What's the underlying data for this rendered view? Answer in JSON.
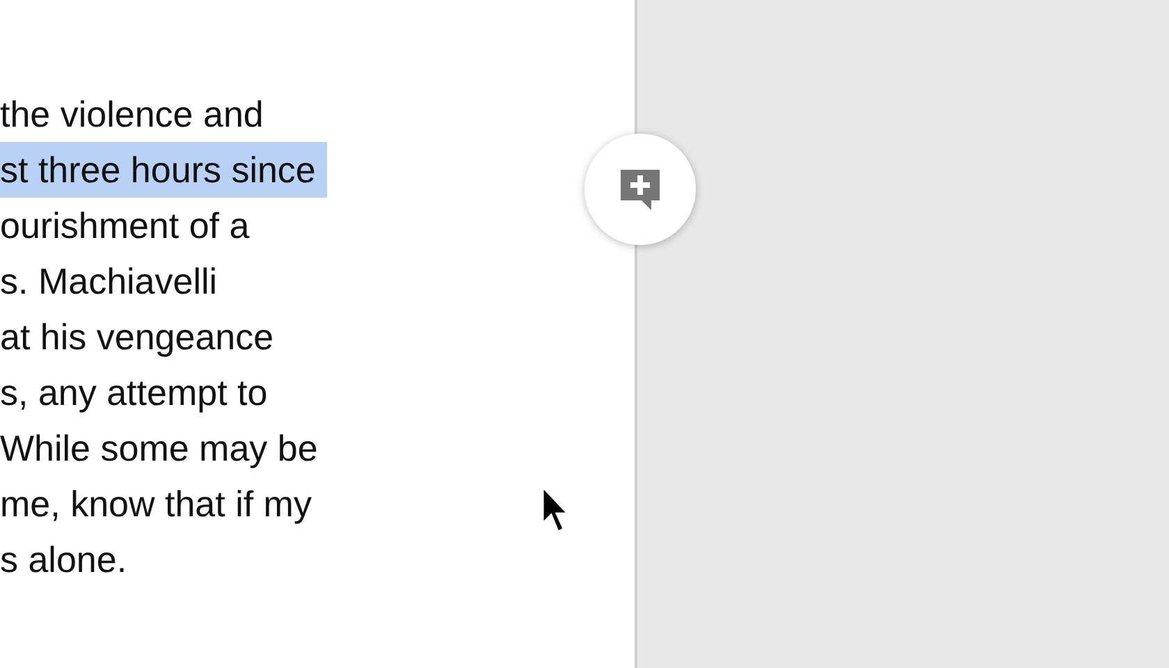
{
  "document": {
    "lines": [
      {
        "text": "the violence and",
        "selected": false
      },
      {
        "text": "st three hours since",
        "selected": true
      },
      {
        "text": "ourishment of a",
        "selected": false
      },
      {
        "text": "s. Machiavelli",
        "selected": false
      },
      {
        "text": "at his vengeance",
        "selected": false
      },
      {
        "text": "s, any attempt to",
        "selected": false
      },
      {
        "text": "While some may be",
        "selected": false
      },
      {
        "text": "me, know that if my",
        "selected": false
      },
      {
        "text": "s alone.",
        "selected": false
      }
    ]
  }
}
